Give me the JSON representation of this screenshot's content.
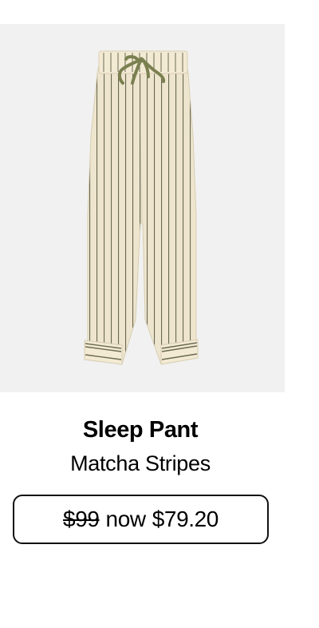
{
  "product": {
    "image_alt": "Sleep Pant in Matcha Stripes",
    "title": "Sleep Pant",
    "variant": "Matcha Stripes",
    "price": {
      "original": "$99",
      "now_label": "now",
      "sale": "$79.20"
    }
  },
  "colors": {
    "image_background": "#f1f1f1",
    "fabric": "#f3ead4",
    "stripe": "#6b6a52",
    "drawstring": "#7b8050",
    "text": "#000000",
    "price_border": "#111111"
  }
}
